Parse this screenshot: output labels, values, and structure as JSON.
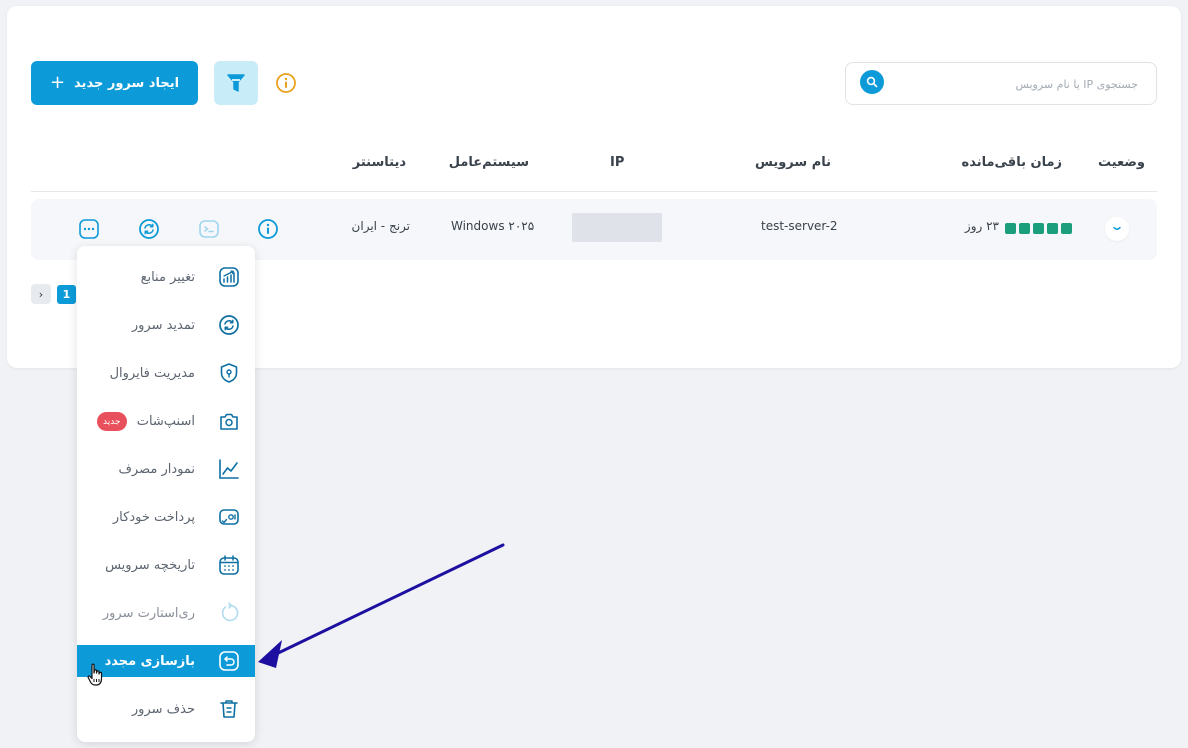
{
  "search": {
    "placeholder": "جستجوی IP یا نام سرویس"
  },
  "toolbar": {
    "create_label": "ایجاد سرور جدید",
    "create_plus": "+"
  },
  "table": {
    "headers": {
      "status": "وضعیت",
      "remaining": "زمان باقی‌مانده",
      "service_name": "نام سرویس",
      "ip": "IP",
      "os": "سیستم‌عامل",
      "datacenter": "دیتاسنتر"
    },
    "rows": [
      {
        "remaining": "۲۳ روز",
        "remaining_level": 5,
        "service_name": "test-server-2",
        "ip": "",
        "os": "Windows ۲۰۲۵",
        "datacenter": "ترنج - ایران"
      }
    ]
  },
  "pagination": {
    "current": "1",
    "next": "›"
  },
  "menu": {
    "items": [
      {
        "label": "تغییر منابع",
        "icon": "resources-chart-icon"
      },
      {
        "label": "تمدید سرور",
        "icon": "renew-icon"
      },
      {
        "label": "مدیریت فایروال",
        "icon": "firewall-shield-icon"
      },
      {
        "label": "اسنپ‌شات",
        "icon": "camera-icon",
        "badge": "جدید"
      },
      {
        "label": "نمودار مصرف",
        "icon": "line-chart-icon"
      },
      {
        "label": "پرداخت خودکار",
        "icon": "auto-pay-icon"
      },
      {
        "label": "تاریخچه سرویس",
        "icon": "calendar-icon"
      },
      {
        "label": "ری‌استارت سرور",
        "icon": "restart-icon",
        "disabled": true
      },
      {
        "label": "بازسازی مجدد",
        "icon": "rebuild-icon",
        "active": true
      },
      {
        "label": "حذف سرور",
        "icon": "trash-icon"
      }
    ]
  },
  "colors": {
    "accent": "#0d9ad8",
    "status_green": "#1b9e7b",
    "badge_red": "#e8505b",
    "arrow": "#1d0fa0",
    "info_orange": "#e8a21d"
  }
}
